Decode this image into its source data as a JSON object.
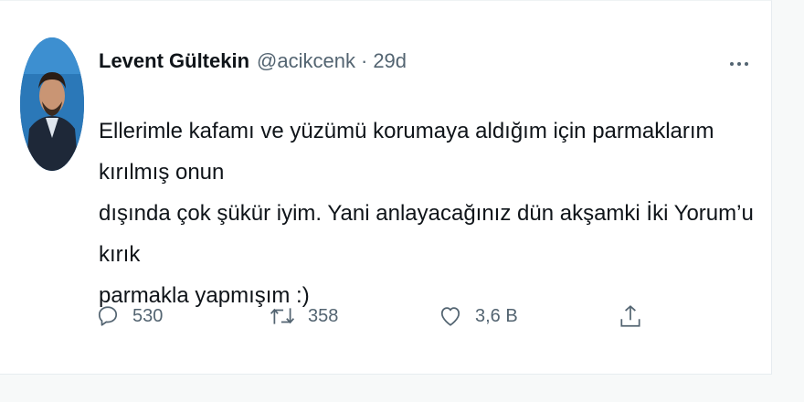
{
  "tweet": {
    "author_name": "Levent Gültekin",
    "handle": "@acikcenk",
    "separator": "·",
    "time": "29d",
    "text": "Ellerimle kafamı ve yüzümü korumaya aldığım için parmaklarım kırılmış onun\ndışında çok şükür iyim. Yani anlayacağınız dün akşamki İki Yorum’u kırık\nparmakla yapmışım :)",
    "replies": "530",
    "retweets": "358",
    "likes": "3,6 B"
  },
  "icons": {
    "reply": "speech-bubble-icon",
    "retweet": "retweet-icon",
    "like": "heart-icon",
    "share": "share-icon",
    "more": "more-dots-icon"
  },
  "colors": {
    "text_primary": "#0f1419",
    "text_secondary": "#536471",
    "avatar_bg": "#2e7fc1"
  }
}
